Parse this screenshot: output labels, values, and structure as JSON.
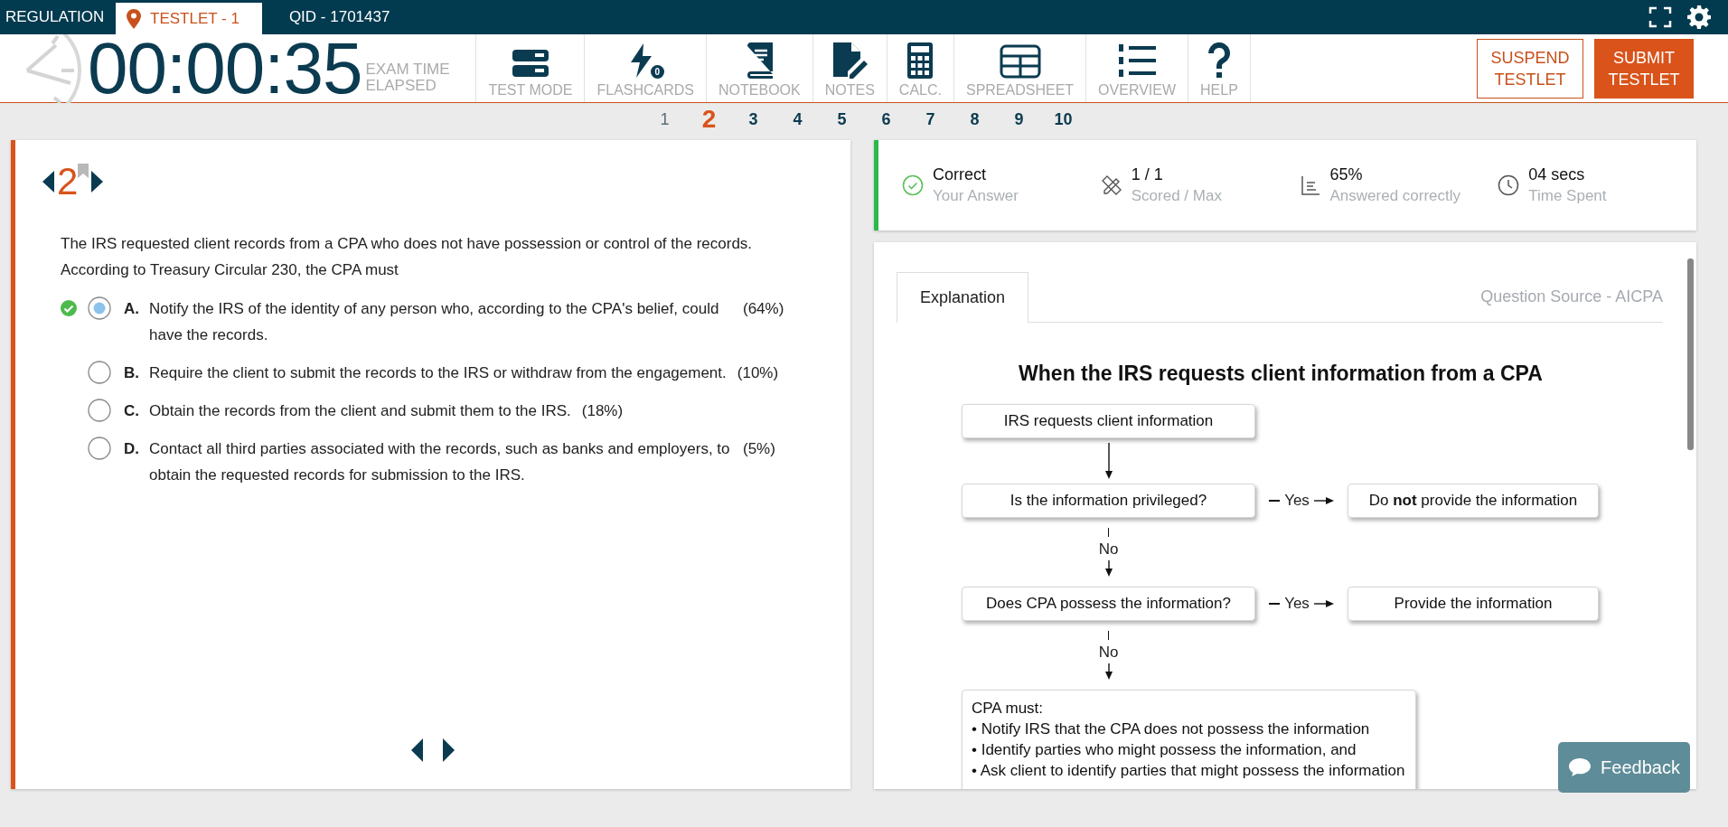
{
  "header": {
    "tabs": [
      {
        "label": "REGULATION",
        "selected": false
      },
      {
        "label": "TESTLET - 1",
        "selected": true
      },
      {
        "label": "QID - 1701437",
        "selected": false
      }
    ]
  },
  "toolbar": {
    "timer": "00:00:35",
    "timer_label": "EXAM TIME ELAPSED",
    "tools": [
      {
        "kind": "testmode",
        "label": "TEST MODE"
      },
      {
        "kind": "flashcards",
        "label": "FLASHCARDS",
        "badge": "0"
      },
      {
        "kind": "notebook",
        "label": "NOTEBOOK"
      },
      {
        "kind": "notes",
        "label": "NOTES"
      },
      {
        "kind": "calc",
        "label": "CALC."
      },
      {
        "kind": "spreadsheet",
        "label": "SPREADSHEET"
      },
      {
        "kind": "overview",
        "label": "OVERVIEW"
      },
      {
        "kind": "help",
        "label": "HELP"
      }
    ],
    "buttons": [
      {
        "kind": "outline",
        "label": "SUSPEND TESTLET"
      },
      {
        "kind": "filled",
        "label": "SUBMIT TESTLET"
      }
    ]
  },
  "question_nav": [
    {
      "label": "1",
      "selected": false,
      "answered": true
    },
    {
      "label": "2",
      "selected": true,
      "answered": false
    },
    {
      "label": "3",
      "selected": false,
      "answered": false
    },
    {
      "label": "4",
      "selected": false,
      "answered": false
    },
    {
      "label": "5",
      "selected": false,
      "answered": false
    },
    {
      "label": "6",
      "selected": false,
      "answered": false
    },
    {
      "label": "7",
      "selected": false,
      "answered": false
    },
    {
      "label": "8",
      "selected": false,
      "answered": false
    },
    {
      "label": "9",
      "selected": false,
      "answered": false
    },
    {
      "label": "10",
      "selected": false,
      "answered": false
    }
  ],
  "question": {
    "number": "2",
    "bookmarked": false,
    "stem": "The IRS requested client records from a CPA who does not have possession or control of the records. According to Treasury Circular 230, the CPA must",
    "choices": [
      {
        "letter": "A.",
        "text": "Notify the IRS of the identity of any person who, according to the CPA's belief, could have the records.",
        "percent": "(64%)",
        "selected": true,
        "correct": true
      },
      {
        "letter": "B.",
        "text": "Require the client to submit the records to the IRS or withdraw from the engagement.",
        "percent": "(10%)",
        "selected": false,
        "correct": false
      },
      {
        "letter": "C.",
        "text": "Obtain the records from the client and submit them to the IRS.",
        "percent": "(18%)",
        "selected": false,
        "correct": false
      },
      {
        "letter": "D.",
        "text": "Contact all third parties associated with the records, such as banks and employers, to obtain the requested records for submission to the IRS.",
        "percent": "(5%)",
        "selected": false,
        "correct": false
      }
    ]
  },
  "stats": {
    "correct": true,
    "items": [
      {
        "kind": "result",
        "value": "Correct",
        "label": "Your Answer"
      },
      {
        "kind": "score",
        "value": "1 / 1",
        "label": "Scored / Max"
      },
      {
        "kind": "percent",
        "value": "65%",
        "label": "Answered correctly"
      },
      {
        "kind": "time",
        "value": "04 secs",
        "label": "Time Spent"
      }
    ]
  },
  "explanation": {
    "tabs": [
      {
        "label": "Explanation",
        "selected": true
      }
    ],
    "source": "Question Source - AICPA",
    "flowchart": {
      "title": "When the IRS requests client information from a CPA",
      "start": "IRS requests client information",
      "steps": [
        {
          "question": "Is the information privileged?",
          "yes_label": "Yes",
          "yes_result": "Do **not** provide the information",
          "no_label": "No"
        },
        {
          "question": "Does CPA possess the information?",
          "yes_label": "Yes",
          "yes_result": "Provide the information",
          "no_label": "No"
        }
      ],
      "final": {
        "heading": "CPA must:",
        "bullets": [
          "• Notify IRS that the CPA does not possess the information",
          "• Identify parties who might possess the information, and",
          "• Ask client to identify parties that might possess the information"
        ]
      }
    }
  },
  "feedback": {
    "label": "Feedback"
  }
}
